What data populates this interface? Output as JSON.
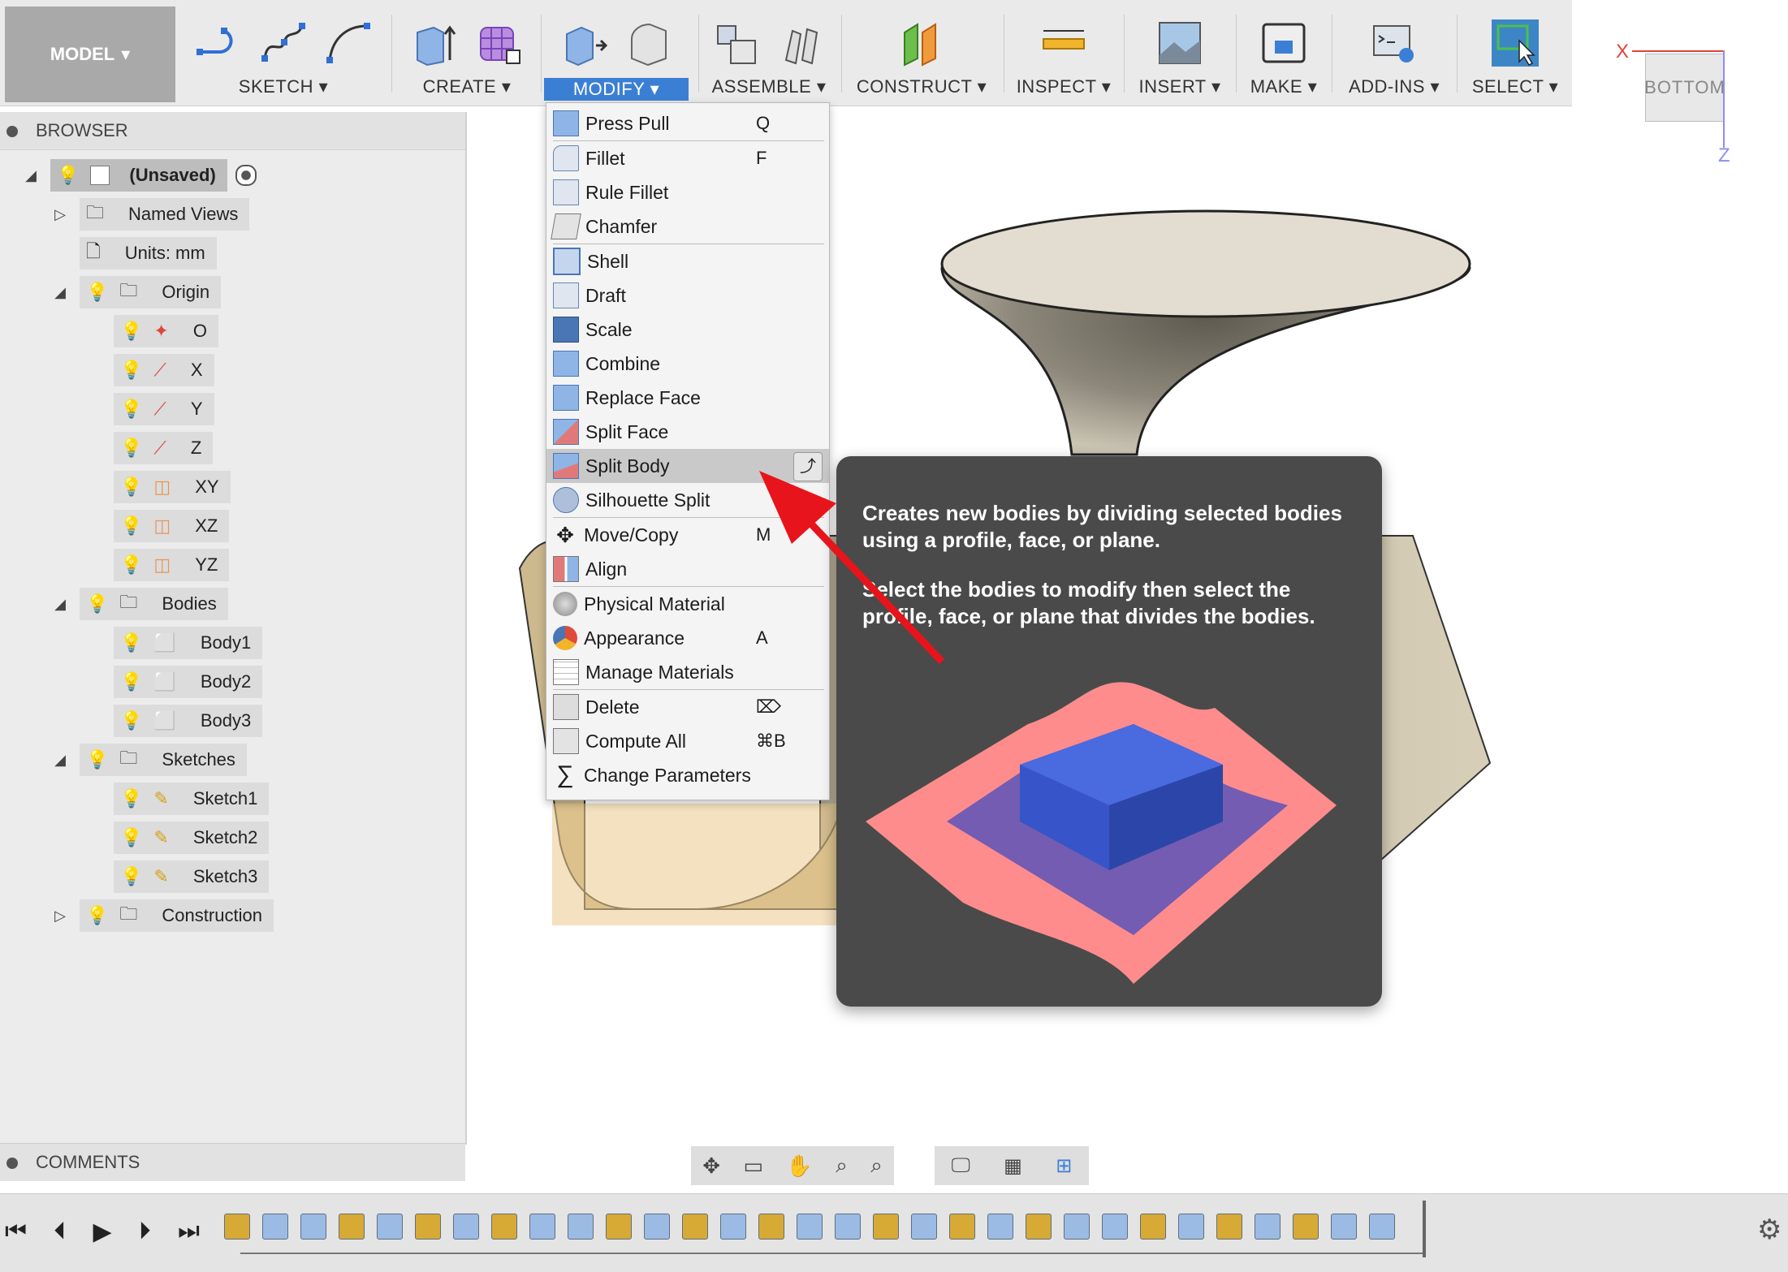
{
  "toolbar": {
    "model_label": "MODEL",
    "groups": [
      "SKETCH",
      "CREATE",
      "MODIFY",
      "ASSEMBLE",
      "CONSTRUCT",
      "INSPECT",
      "INSERT",
      "MAKE",
      "ADD-INS",
      "SELECT"
    ],
    "active_group": "MODIFY",
    "accent": "#3b7fd4"
  },
  "viewcube": {
    "face_label": "BOTTOM",
    "x_label": "X",
    "z_label": "Z"
  },
  "browser": {
    "title": "BROWSER",
    "root": "(Unsaved)",
    "named_views": "Named Views",
    "units": "Units: mm",
    "origin": {
      "label": "Origin",
      "items": [
        "O",
        "X",
        "Y",
        "Z",
        "XY",
        "XZ",
        "YZ"
      ]
    },
    "bodies": {
      "label": "Bodies",
      "items": [
        "Body1",
        "Body2",
        "Body3"
      ]
    },
    "sketches": {
      "label": "Sketches",
      "items": [
        "Sketch1",
        "Sketch2",
        "Sketch3"
      ]
    },
    "construction": "Construction"
  },
  "comments": {
    "title": "COMMENTS"
  },
  "menu": {
    "items": [
      {
        "label": "Press Pull",
        "key": "Q",
        "icon": "press-pull-icon"
      },
      {
        "label": "Fillet",
        "key": "F",
        "icon": "fillet-icon"
      },
      {
        "label": "Rule Fillet",
        "key": "",
        "icon": "rule-fillet-icon"
      },
      {
        "label": "Chamfer",
        "key": "",
        "icon": "chamfer-icon"
      },
      {
        "label": "Shell",
        "key": "",
        "icon": "shell-icon"
      },
      {
        "label": "Draft",
        "key": "",
        "icon": "draft-icon"
      },
      {
        "label": "Scale",
        "key": "",
        "icon": "scale-icon"
      },
      {
        "label": "Combine",
        "key": "",
        "icon": "combine-icon"
      },
      {
        "label": "Replace Face",
        "key": "",
        "icon": "replace-face-icon"
      },
      {
        "label": "Split Face",
        "key": "",
        "icon": "split-face-icon"
      },
      {
        "label": "Split Body",
        "key": "",
        "icon": "split-body-icon"
      },
      {
        "label": "Silhouette Split",
        "key": "",
        "icon": "silhouette-split-icon"
      },
      {
        "label": "Move/Copy",
        "key": "M",
        "icon": "move-copy-icon"
      },
      {
        "label": "Align",
        "key": "",
        "icon": "align-icon"
      },
      {
        "label": "Physical Material",
        "key": "",
        "icon": "physical-material-icon"
      },
      {
        "label": "Appearance",
        "key": "A",
        "icon": "appearance-icon"
      },
      {
        "label": "Manage Materials",
        "key": "",
        "icon": "manage-materials-icon"
      },
      {
        "label": "Delete",
        "key": "⌦",
        "icon": "delete-icon"
      },
      {
        "label": "Compute All",
        "key": "⌘B",
        "icon": "compute-all-icon"
      },
      {
        "label": "Change Parameters",
        "key": "",
        "icon": "change-parameters-icon"
      }
    ],
    "highlighted": "Split Body"
  },
  "tooltip": {
    "line1": "Creates new bodies by dividing selected bodies using a profile, face, or plane.",
    "line2": "Select the bodies to modify then select the profile, face, or plane that divides the bodies."
  }
}
